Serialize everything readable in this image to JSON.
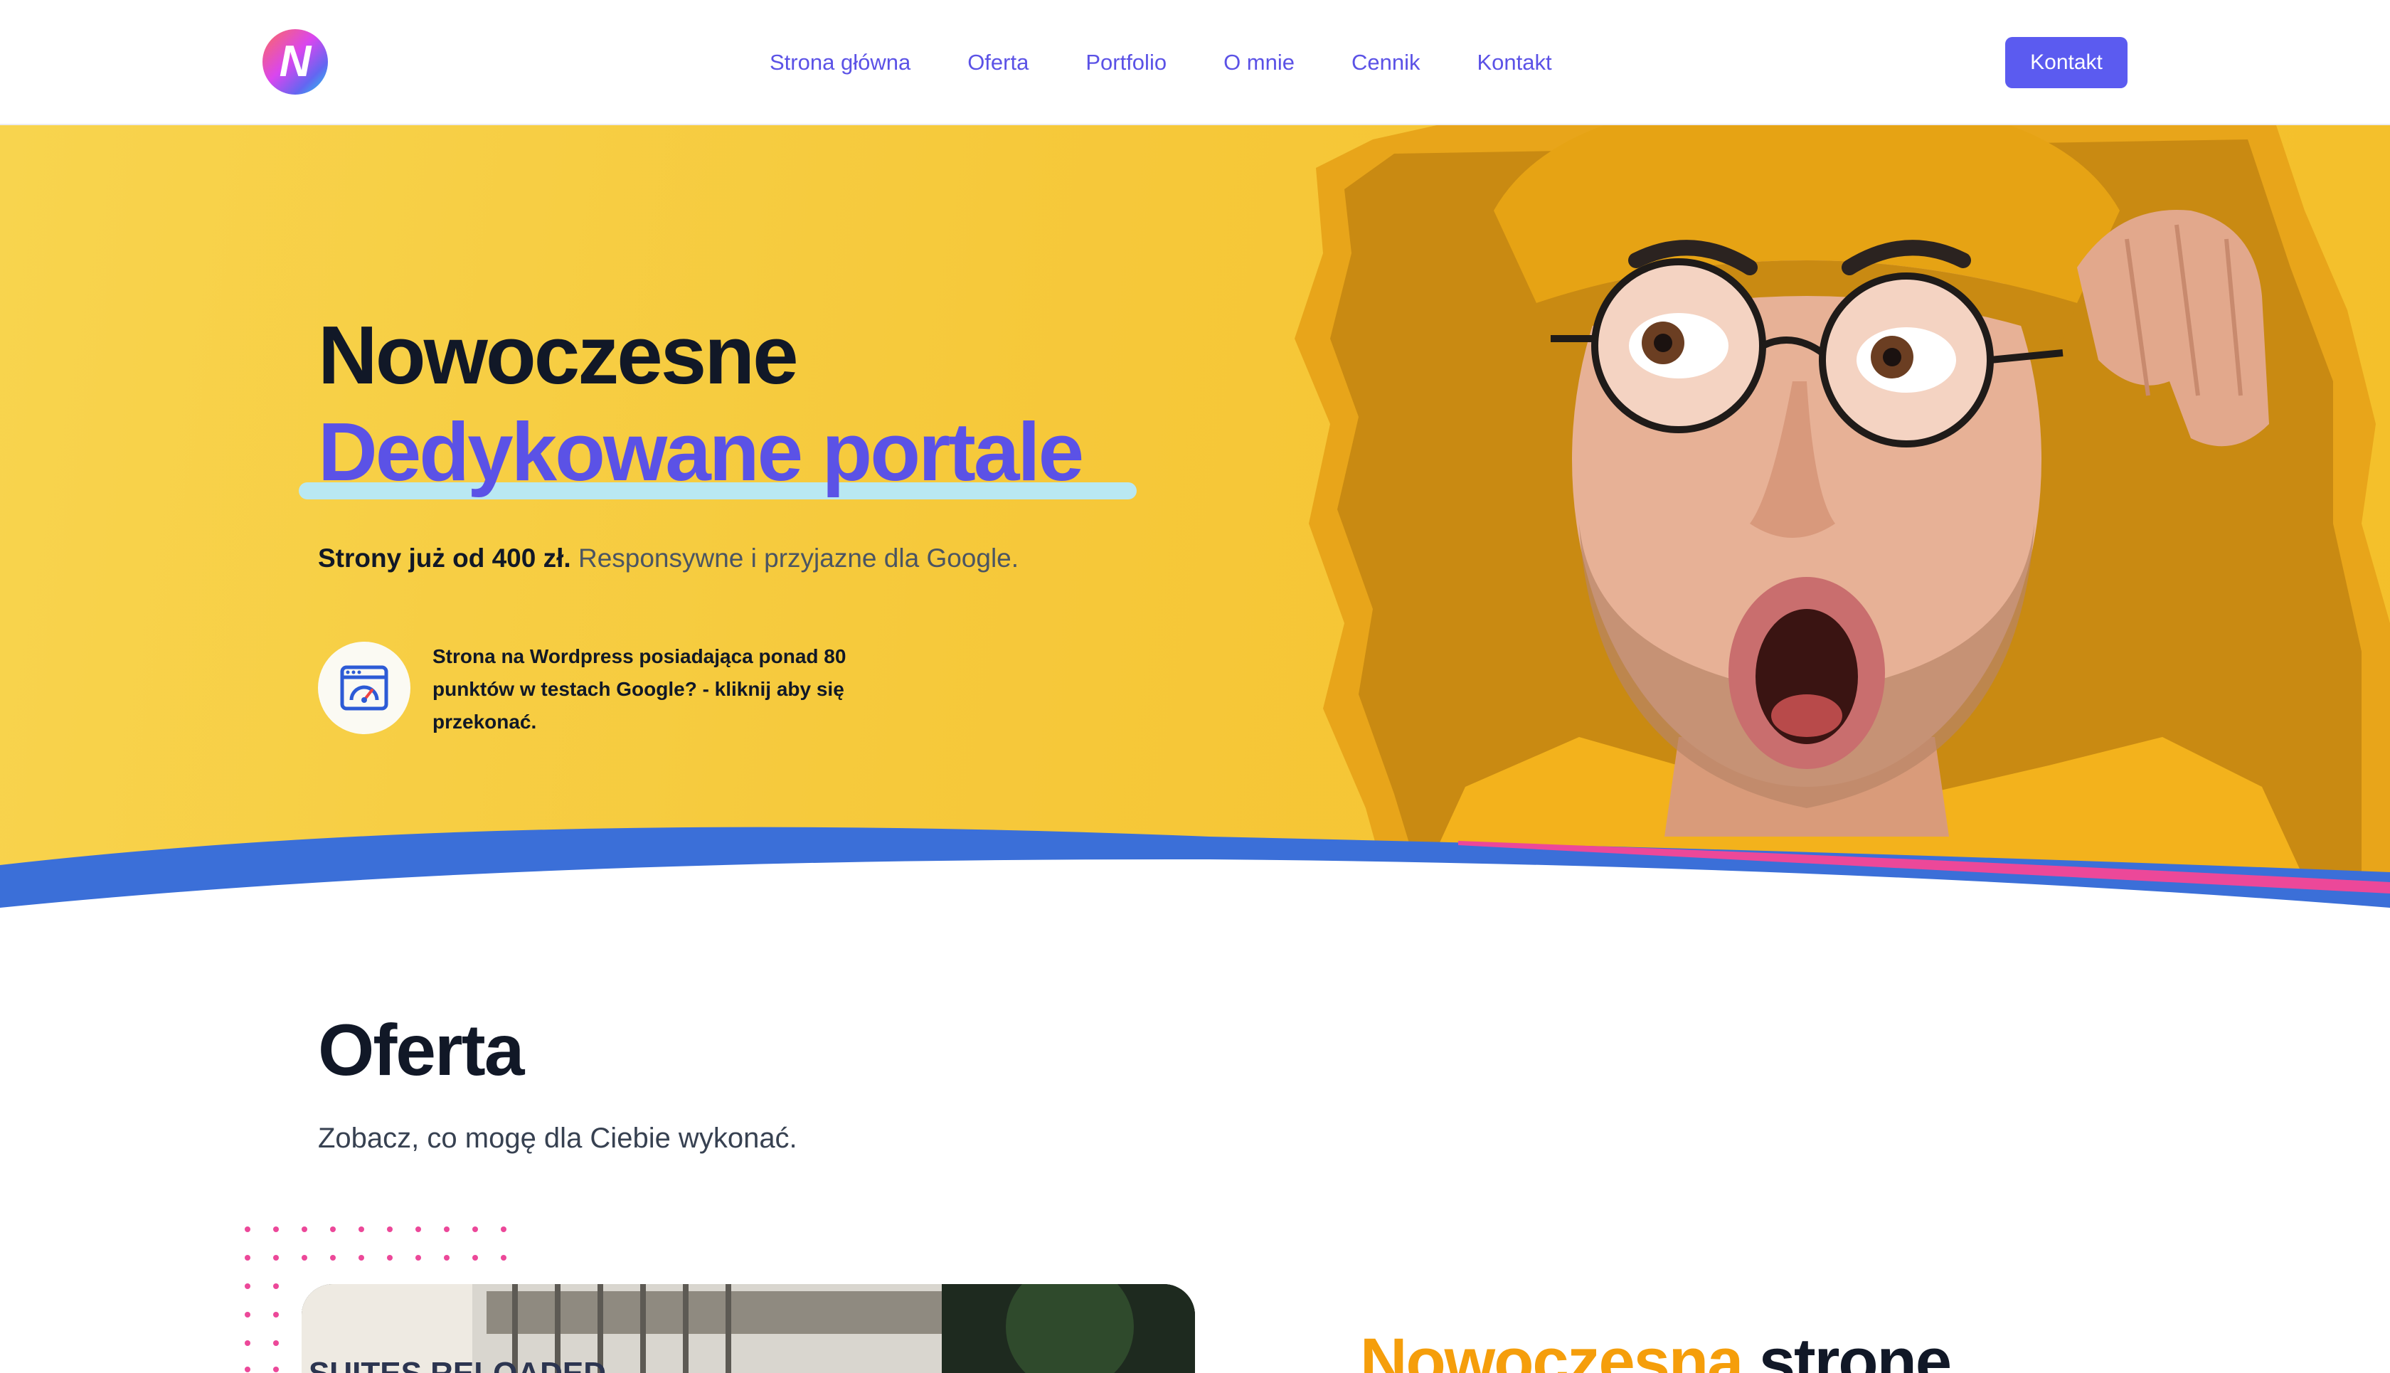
{
  "header": {
    "logo_letter": "N",
    "nav": [
      "Strona główna",
      "Oferta",
      "Portfolio",
      "O mnie",
      "Cennik",
      "Kontakt"
    ],
    "cta_label": "Kontakt"
  },
  "hero": {
    "title_line1": "Nowoczesne",
    "title_line2": "Dedykowane portale",
    "subtitle_bold": "Strony już od 400 zł.",
    "subtitle_rest": "Responsywne i przyjazne dla Google.",
    "badge_icon": "speed-gauge-browser-icon",
    "badge_text": "Strona na Wordpress posiadająca ponad 80 punktów w testach Google? - kliknij aby się przekonać."
  },
  "offer": {
    "title": "Oferta",
    "subtitle": "Zobacz, co mogę dla Ciebie wykonać.",
    "heading_accent": "Nowoczesna",
    "heading_rest": "strone",
    "image_text": "SUITES RELOADED"
  },
  "colors": {
    "accent": "#5b52e6",
    "hero_yellow": "#f6c93b",
    "underline": "#b9e8f2",
    "wave_blue": "#3b6fd8",
    "wave_pink": "#ec4899",
    "orange": "#f59e0b"
  }
}
